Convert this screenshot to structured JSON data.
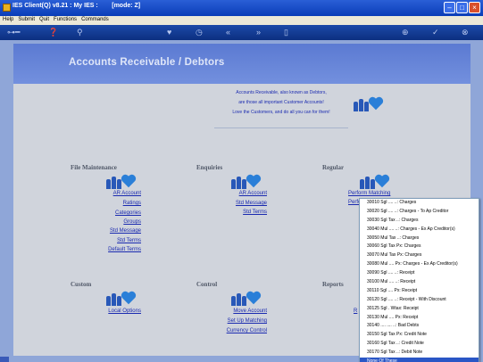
{
  "window": {
    "title": "IES Client(Q) v8.21 : My IES :        [mode: Z]"
  },
  "menu": [
    "Help",
    "Submit",
    "Quit",
    "Functions",
    "Commands"
  ],
  "toolbar_icons": [
    "key-icon",
    "help-icon",
    "search-icon",
    "heart-icon",
    "clock-icon",
    "rewind-icon",
    "forward-icon",
    "doc-icon",
    "plus-icon",
    "check-icon",
    "close-icon"
  ],
  "page": {
    "title": "Accounts Receivable / Debtors",
    "intro_line1": "Accounts Receivable, also known as Debtors,",
    "intro_line2": "are those  all important Customer Accounts!",
    "intro_line3": "Love the Customers, and do all you can for them!"
  },
  "sections": {
    "file_maintenance": {
      "title": "File Maintenance",
      "links": [
        "AR Account",
        "Ratings",
        "Categories",
        "Groups",
        "Std Message",
        "Std Terms",
        "Default Terms"
      ]
    },
    "enquiries": {
      "title": "Enquiries",
      "links": [
        "AR Account",
        "Std Message",
        "Std Terms"
      ]
    },
    "regular": {
      "title": "Regular",
      "links": [
        "Perform Matching",
        "Perfo"
      ]
    },
    "custom": {
      "title": "Custom",
      "links": [
        "Local Options"
      ]
    },
    "control": {
      "title": "Control",
      "links": [
        "Move Account",
        "Set Up Matching",
        "Currency Control"
      ]
    },
    "reports": {
      "title": "Reports",
      "links": [
        "R"
      ]
    }
  },
  "dropdown": {
    "items": [
      "30010 Sgl .... ..: Charges",
      "30020 Sgl .... ..: Charges - To Ap Creditor",
      "30030 Sgl Tax ..: Charges",
      "30040 Mul .... ..: Charges - Ex Ap Creditor(s)",
      "30050 Mul Tax ..: Charges",
      "30060 Sgl Tax Px: Charges",
      "30070 Mul Tax Px: Charges",
      "30080 Mul .... Px: Charges - Ex Ap Creditor(s)",
      "30090 Sgl .... ..: Receipt",
      "30100 Mul .... ..: Receipt",
      "30110 Sgl .... Px: Receipt",
      "30120 Sgl .... ..: Receipt - With Discount",
      "30125 Sgl . Wtax: Receipt",
      "30130 Mul .... Px: Receipt",
      "30140 .... .... ..: Bad Debts",
      "30150 Sgl Tax Px: Credit Note",
      "30160 Sgl Tax ..: Credit Note",
      "30170 Sgl Tax ..: Debit Note",
      "None Of These"
    ],
    "selected_index": 18
  },
  "colors": {
    "link": "#1a2ab0",
    "banner": "#5b7ad2",
    "selection": "#2a56c6"
  }
}
